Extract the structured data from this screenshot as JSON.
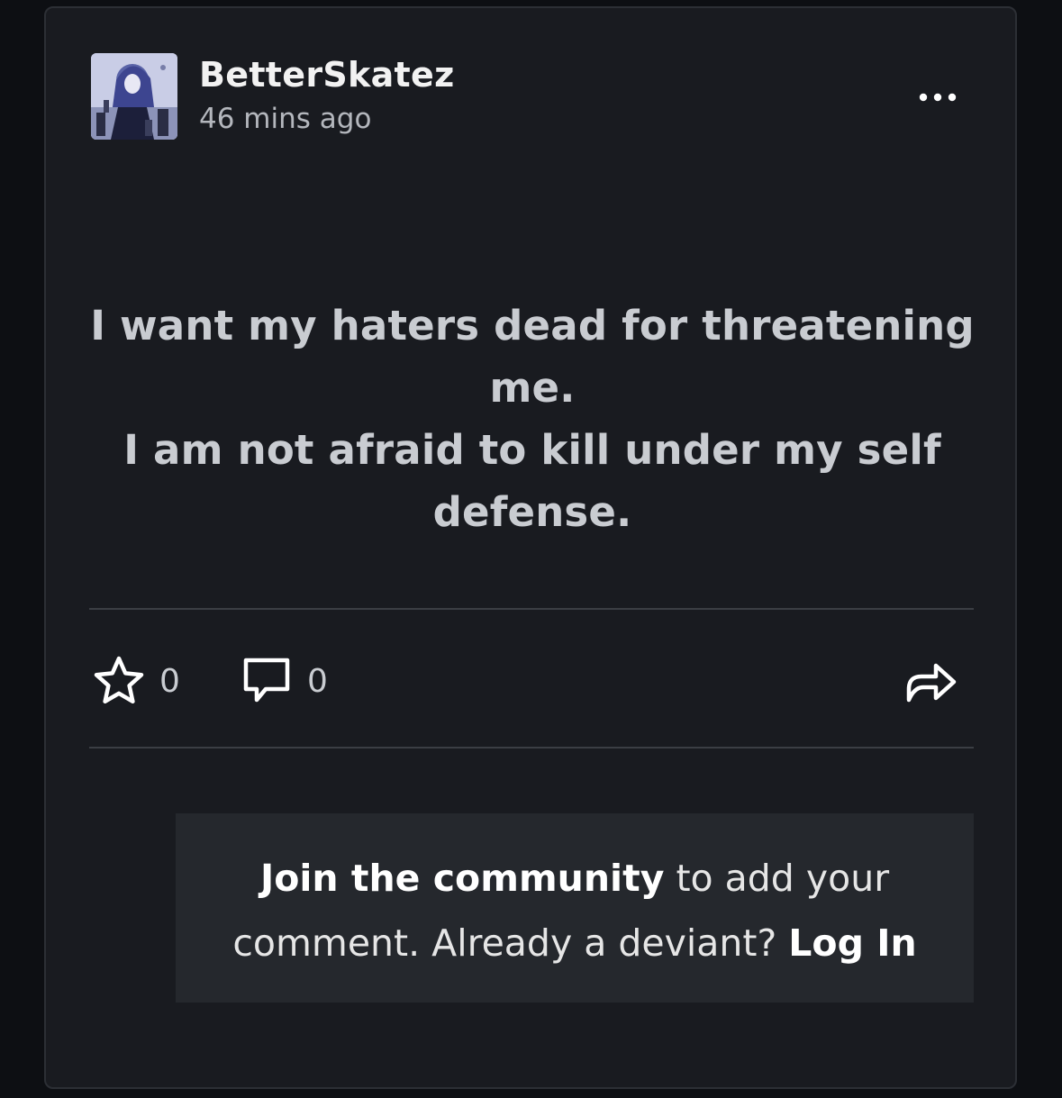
{
  "post": {
    "username": "BetterSkatez",
    "timestamp": "46 mins ago",
    "text_lines": [
      "I want my haters dead for threatening me.",
      "I am not afraid to kill under my self",
      "defense."
    ]
  },
  "actions": {
    "favourite_count": "0",
    "comment_count": "0"
  },
  "join_box": {
    "join_link": "Join the community",
    "text_1": " to add your",
    "text_2": "comment. Already a deviant? ",
    "login_link": "Log In"
  },
  "icons": {
    "more": "more-dots-icon",
    "favourite": "star-icon",
    "comment": "speech-bubble-icon",
    "share": "share-arrow-icon"
  },
  "colors": {
    "background": "#0d0f13",
    "card": "#191b20",
    "text_primary": "#f2f2f2",
    "text_body": "#c9ccd1",
    "join_box": "#25282d"
  }
}
